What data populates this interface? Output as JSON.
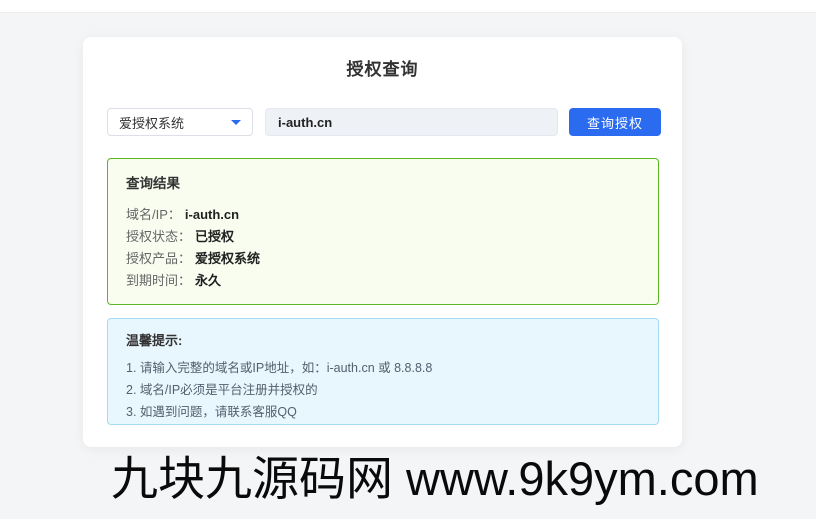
{
  "page": {
    "title": "授权查询"
  },
  "query_form": {
    "product_select": {
      "value": "爱授权系统"
    },
    "domain_input": {
      "value": "i-auth.cn"
    },
    "submit_label": "查询授权"
  },
  "result": {
    "header": "查询结果",
    "rows": [
      {
        "label": "域名/IP：",
        "value": "i-auth.cn"
      },
      {
        "label": "授权状态：",
        "value": "已授权"
      },
      {
        "label": "授权产品：",
        "value": "爱授权系统"
      },
      {
        "label": "到期时间：",
        "value": "永久"
      }
    ]
  },
  "tips": {
    "header": "温馨提示:",
    "items": [
      "1. 请输入完整的域名或IP地址，如：i-auth.cn 或 8.8.8.8",
      "2. 域名/IP必须是平台注册并授权的",
      "3. 如遇到问题，请联系客服QQ"
    ]
  },
  "watermark": "九块九源码网 www.9k9ym.com",
  "icons": {
    "select_caret": "chevron-down"
  },
  "colors": {
    "accent_blue": "#2b6bef",
    "success_border": "#5cb724",
    "success_bg": "#f8fdf0",
    "info_border": "#a6daf0",
    "info_bg": "#e8f6fd",
    "page_bg": "#f4f5f7"
  }
}
